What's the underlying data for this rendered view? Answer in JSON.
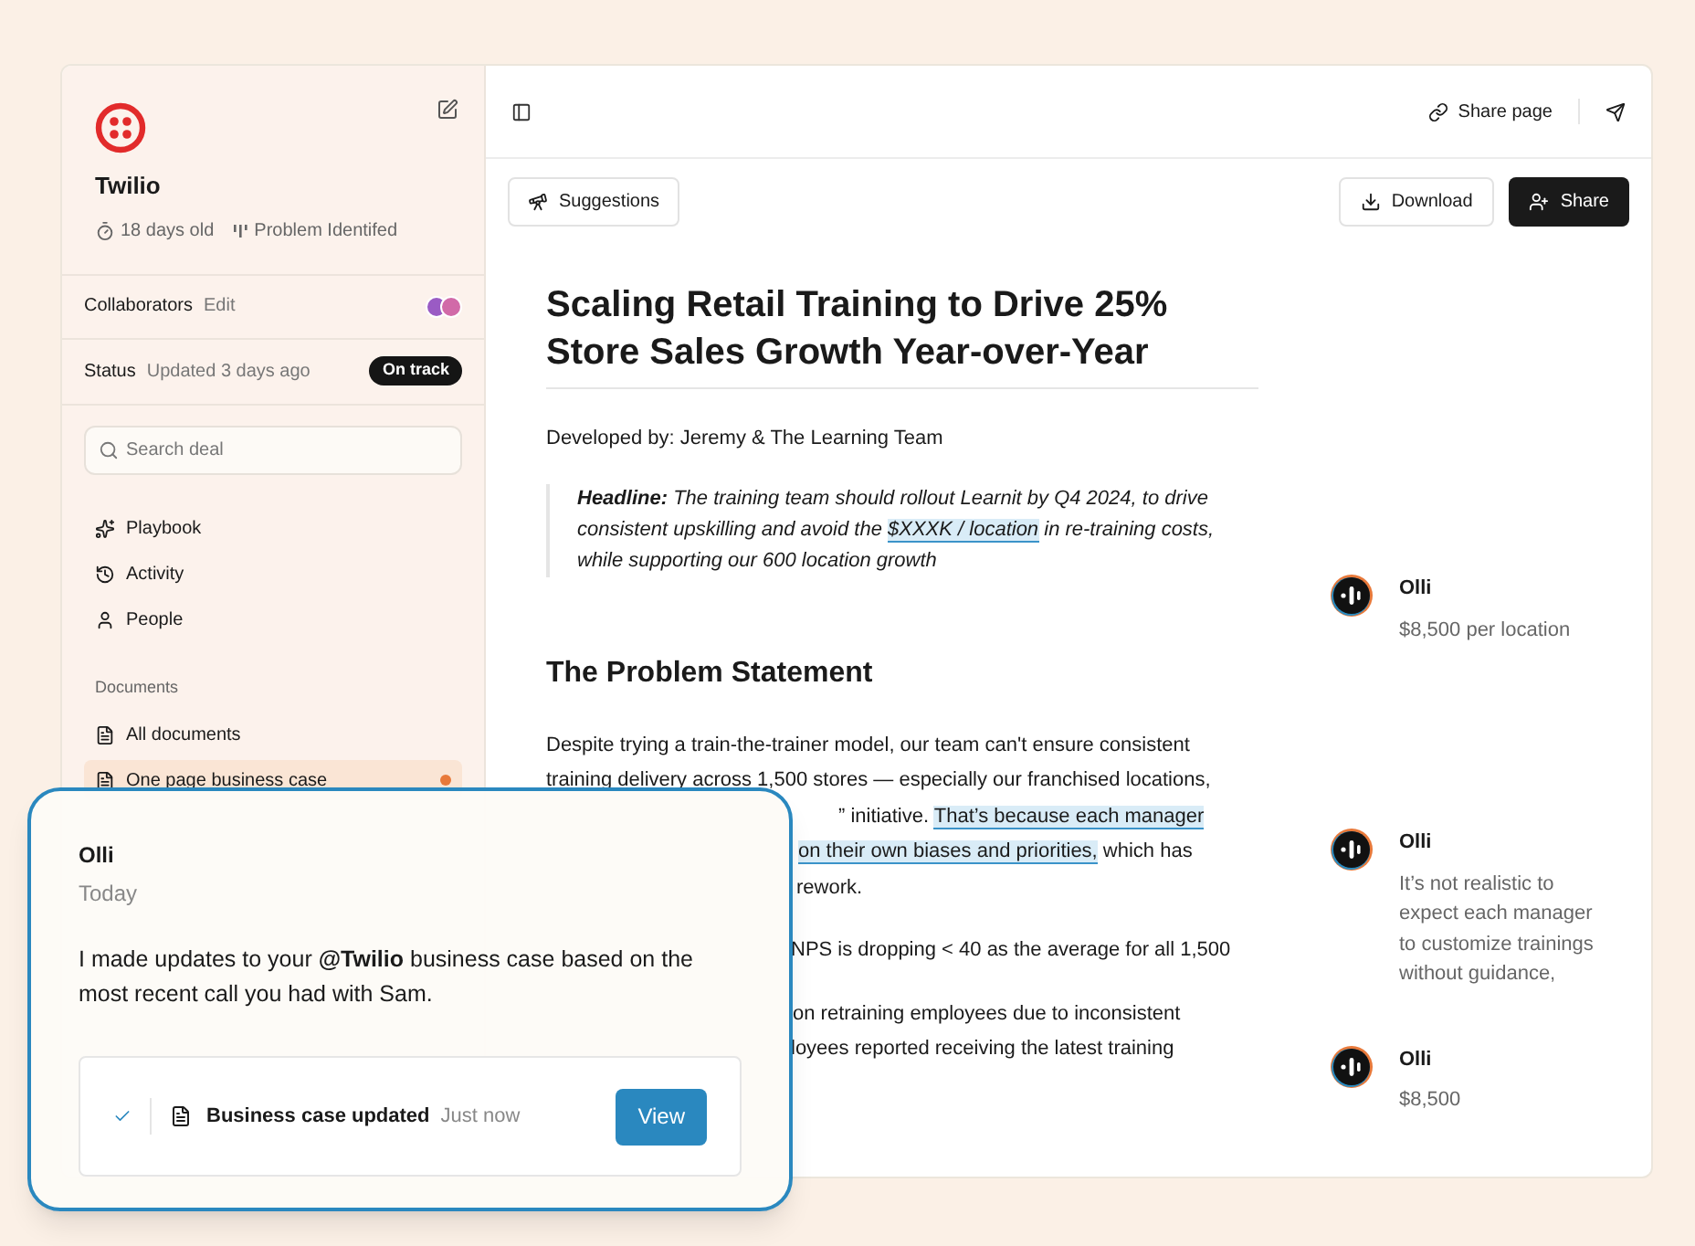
{
  "deal": {
    "name": "Twilio",
    "age": "18 days old",
    "stage": "Problem Identifed"
  },
  "collaborators": {
    "label": "Collaborators",
    "action": "Edit"
  },
  "status": {
    "label": "Status",
    "updated": "Updated 3 days ago",
    "badge": "On track"
  },
  "search": {
    "placeholder": "Search deal"
  },
  "nav": [
    {
      "kind": "playbook",
      "label": "Playbook",
      "selected": false
    },
    {
      "kind": "activity",
      "label": "Activity",
      "selected": false
    },
    {
      "kind": "people",
      "label": "People",
      "selected": false
    }
  ],
  "documents": {
    "heading": "Documents",
    "items": [
      {
        "label": "All documents",
        "selected": false,
        "unread": false
      },
      {
        "label": "One page business case",
        "selected": true,
        "unread": true
      }
    ]
  },
  "topbar": {
    "share_page": "Share page"
  },
  "toolbar": {
    "suggestions": "Suggestions",
    "download": "Download",
    "share": "Share"
  },
  "doc": {
    "title": "Scaling Retail Training to Drive 25% Store Sales Growth Year-over-Year",
    "author": "Developed by: Jeremy & The Learning Team",
    "headline": [
      {
        "text": "**Headline:** The training team should rollout Learnit by Q4 2024, to drive consistent upskilling and avoid the ",
        "highlighted": false
      },
      {
        "text": "$XXXK / location",
        "highlighted": true
      },
      {
        "text": " in re-training costs, while supporting our 600 location growth",
        "highlighted": false
      }
    ],
    "section": "The Problem Statement",
    "lines": [
      {
        "segments": [
          {
            "text": "Despite trying a train-the-trainer model, our team can't ensure consistent",
            "highlighted": false
          }
        ]
      },
      {
        "segments": [
          {
            "text": "training delivery across 1,500 stores — especially our franchised locations,",
            "highlighted": false
          }
        ]
      },
      {
        "segments": [
          {
            "text": "” initiative. ",
            "highlighted": false
          },
          {
            "text": "That’s because each manager",
            "highlighted": true
          }
        ]
      },
      {
        "segments": [
          {
            "text": "on their own biases and priorities,",
            "highlighted": true
          },
          {
            "text": " which has",
            "highlighted": false
          }
        ]
      },
      {
        "segments": [
          {
            "text": "rework.",
            "highlighted": false
          }
        ]
      },
      {
        "segments": [
          {
            "text": "NPS is dropping < 40 as the average for all 1,500",
            "highlighted": false
          }
        ]
      },
      {
        "segments": [
          {
            "text": "on retraining employees due to inconsistent",
            "highlighted": false
          }
        ]
      },
      {
        "segments": [
          {
            "text": "loyees reported receiving the latest training",
            "highlighted": false
          }
        ]
      }
    ]
  },
  "comments": [
    {
      "author": "Olli",
      "text": "$8,500 per location"
    },
    {
      "author": "Olli",
      "text": "It’s not realistic to expect each manager to customize trainings without guidance,"
    },
    {
      "author": "Olli",
      "text": "$8,500"
    }
  ],
  "notification": {
    "author": "Olli",
    "time": "Today",
    "message": "I made updates to your **@Twilio** business case based on the most recent call you had with Sam.",
    "event": {
      "done": true,
      "title": "Business case updated",
      "time": "Just now",
      "action": "View"
    }
  }
}
